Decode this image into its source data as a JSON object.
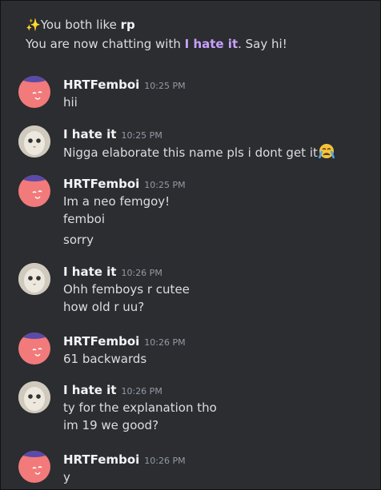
{
  "intro": {
    "like_prefix": "You both like ",
    "like_topic": "rp",
    "chat_prefix": "You are now chatting with ",
    "chat_partner": "I hate it",
    "chat_suffix": ". Say hi!"
  },
  "messages": [
    {
      "author": "HRTFemboi",
      "time": "10:25 PM",
      "lines": [
        "hii"
      ]
    },
    {
      "author": "I hate it",
      "time": "10:25 PM",
      "lines": [
        "Nigga elaborate this name pls i dont get it"
      ]
    },
    {
      "author": "HRTFemboi",
      "time": "10:25 PM",
      "lines": [
        "Im a neo femgoy!",
        "femboi",
        "sorry"
      ]
    },
    {
      "author": "I hate it",
      "time": "10:26 PM",
      "lines": [
        "Ohh femboys r cutee",
        "how old r uu?"
      ]
    },
    {
      "author": "HRTFemboi",
      "time": "10:26 PM",
      "lines": [
        "61 backwards"
      ]
    },
    {
      "author": "I hate it",
      "time": "10:26 PM",
      "lines": [
        "ty for the explanation tho",
        "im 19 we good?"
      ]
    },
    {
      "author": "HRTFemboi",
      "time": "10:26 PM",
      "lines": [
        "y"
      ]
    }
  ]
}
